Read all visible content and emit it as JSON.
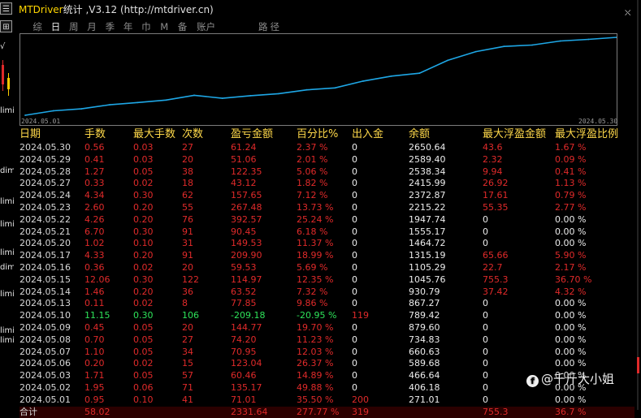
{
  "window": {
    "title_en": "MTDriver",
    "title_cn": "统计",
    "title_version": " ,V3.12 (http://mtdriver.cn)",
    "menu_glyph": "☰",
    "sidebar_icon_glyph": "⊞",
    "close_glyph": "⛌"
  },
  "left_strip_labels": [
    {
      "text": "√"
    },
    {
      "text": "limi"
    },
    {
      "text": "dimi"
    },
    {
      "text": "limi"
    },
    {
      "text": "limi"
    },
    {
      "text": "limi"
    },
    {
      "text": "dimi"
    },
    {
      "text": "limi"
    },
    {
      "text": "limi"
    },
    {
      "text": "limi"
    }
  ],
  "period_tabs": [
    {
      "label": "综",
      "active": false
    },
    {
      "label": "日",
      "active": true
    },
    {
      "label": "周",
      "active": false
    },
    {
      "label": "月",
      "active": false
    },
    {
      "label": "季",
      "active": false
    },
    {
      "label": "年",
      "active": false
    },
    {
      "label": "巾",
      "active": false
    },
    {
      "label": "M",
      "active": false
    },
    {
      "label": "备",
      "active": false
    },
    {
      "label": "账户",
      "active": false
    }
  ],
  "route_tab": "路径",
  "chart_data": {
    "type": "line",
    "x_start_label": "2024.05.01",
    "x_end_label": "2024.05.30",
    "x": [
      "2024.05.01",
      "2024.05.02",
      "2024.05.03",
      "2024.05.06",
      "2024.05.07",
      "2024.05.08",
      "2024.05.09",
      "2024.05.10",
      "2024.05.13",
      "2024.05.14",
      "2024.05.15",
      "2024.05.16",
      "2024.05.17",
      "2024.05.20",
      "2024.05.21",
      "2024.05.22",
      "2024.05.23",
      "2024.05.24",
      "2024.05.27",
      "2024.05.28",
      "2024.05.29",
      "2024.05.30"
    ],
    "values": [
      271.01,
      406.18,
      466.64,
      589.68,
      660.63,
      734.83,
      879.6,
      789.42,
      867.27,
      930.79,
      1045.76,
      1105.29,
      1315.19,
      1464.72,
      1555.17,
      1947.74,
      2215.22,
      2372.87,
      2415.99,
      2538.34,
      2589.4,
      2650.64
    ],
    "line_color": "#1ea7e6",
    "grid": false
  },
  "table": {
    "headers": [
      "日期",
      "手数",
      "最大手数",
      "次数",
      "盈亏金额",
      "百分比%",
      "出入金",
      "余额",
      "最大浮盈金额",
      "最大浮盈比例"
    ],
    "rows": [
      {
        "date": "2024.05.30",
        "lots": "0.56",
        "max_lots": "0.03",
        "count": "27",
        "pnl": "61.24",
        "pct": "2.37 %",
        "io": "0",
        "balance": "2650.64",
        "fp_amt": "43.6",
        "fp_pct": "1.67 %",
        "tone": "red"
      },
      {
        "date": "2024.05.29",
        "lots": "0.41",
        "max_lots": "0.03",
        "count": "20",
        "pnl": "51.06",
        "pct": "2.01 %",
        "io": "0",
        "balance": "2589.40",
        "fp_amt": "2.32",
        "fp_pct": "0.09 %",
        "tone": "red"
      },
      {
        "date": "2024.05.28",
        "lots": "1.27",
        "max_lots": "0.05",
        "count": "38",
        "pnl": "122.35",
        "pct": "5.06 %",
        "io": "0",
        "balance": "2538.34",
        "fp_amt": "9.94",
        "fp_pct": "0.41 %",
        "tone": "red"
      },
      {
        "date": "2024.05.27",
        "lots": "0.33",
        "max_lots": "0.02",
        "count": "18",
        "pnl": "43.12",
        "pct": "1.82 %",
        "io": "0",
        "balance": "2415.99",
        "fp_amt": "26.92",
        "fp_pct": "1.13 %",
        "tone": "red"
      },
      {
        "date": "2024.05.24",
        "lots": "4.34",
        "max_lots": "0.30",
        "count": "62",
        "pnl": "157.65",
        "pct": "7.12 %",
        "io": "0",
        "balance": "2372.87",
        "fp_amt": "17.61",
        "fp_pct": "0.79 %",
        "tone": "red"
      },
      {
        "date": "2024.05.23",
        "lots": "2.60",
        "max_lots": "0.20",
        "count": "55",
        "pnl": "267.48",
        "pct": "13.73 %",
        "io": "0",
        "balance": "2215.22",
        "fp_amt": "55.35",
        "fp_pct": "2.77 %",
        "tone": "red"
      },
      {
        "date": "2024.05.22",
        "lots": "4.26",
        "max_lots": "0.20",
        "count": "76",
        "pnl": "392.57",
        "pct": "25.24 %",
        "io": "0",
        "balance": "1947.74",
        "fp_amt": "0",
        "fp_pct": "0.00 %",
        "tone": "red"
      },
      {
        "date": "2024.05.21",
        "lots": "6.70",
        "max_lots": "0.30",
        "count": "91",
        "pnl": "90.45",
        "pct": "6.18 %",
        "io": "0",
        "balance": "1555.17",
        "fp_amt": "0",
        "fp_pct": "0.00 %",
        "tone": "red"
      },
      {
        "date": "2024.05.20",
        "lots": "1.02",
        "max_lots": "0.10",
        "count": "31",
        "pnl": "149.53",
        "pct": "11.37 %",
        "io": "0",
        "balance": "1464.72",
        "fp_amt": "0",
        "fp_pct": "0.00 %",
        "tone": "red"
      },
      {
        "date": "2024.05.17",
        "lots": "4.33",
        "max_lots": "0.20",
        "count": "91",
        "pnl": "209.90",
        "pct": "18.99 %",
        "io": "0",
        "balance": "1315.19",
        "fp_amt": "65.66",
        "fp_pct": "5.90 %",
        "tone": "red"
      },
      {
        "date": "2024.05.16",
        "lots": "0.36",
        "max_lots": "0.02",
        "count": "20",
        "pnl": "59.53",
        "pct": "5.69 %",
        "io": "0",
        "balance": "1105.29",
        "fp_amt": "22.7",
        "fp_pct": "2.17 %",
        "tone": "red"
      },
      {
        "date": "2024.05.15",
        "lots": "12.06",
        "max_lots": "0.30",
        "count": "122",
        "pnl": "114.97",
        "pct": "12.35 %",
        "io": "0",
        "balance": "1045.76",
        "fp_amt": "755.3",
        "fp_pct": "36.70 %",
        "tone": "red"
      },
      {
        "date": "2024.05.14",
        "lots": "1.46",
        "max_lots": "0.20",
        "count": "36",
        "pnl": "63.52",
        "pct": "7.32 %",
        "io": "0",
        "balance": "930.79",
        "fp_amt": "37.42",
        "fp_pct": "4.32 %",
        "tone": "red"
      },
      {
        "date": "2024.05.13",
        "lots": "0.11",
        "max_lots": "0.02",
        "count": "8",
        "pnl": "77.85",
        "pct": "9.86 %",
        "io": "0",
        "balance": "867.27",
        "fp_amt": "0",
        "fp_pct": "0.00 %",
        "tone": "red"
      },
      {
        "date": "2024.05.10",
        "lots": "11.15",
        "max_lots": "0.30",
        "count": "106",
        "pnl": "-209.18",
        "pct": "-20.95 %",
        "io": "119",
        "balance": "789.42",
        "fp_amt": "0",
        "fp_pct": "0.00 %",
        "tone": "green"
      },
      {
        "date": "2024.05.09",
        "lots": "0.45",
        "max_lots": "0.05",
        "count": "20",
        "pnl": "144.77",
        "pct": "19.70 %",
        "io": "0",
        "balance": "879.60",
        "fp_amt": "0",
        "fp_pct": "0.00 %",
        "tone": "red"
      },
      {
        "date": "2024.05.08",
        "lots": "0.70",
        "max_lots": "0.05",
        "count": "27",
        "pnl": "74.20",
        "pct": "11.23 %",
        "io": "0",
        "balance": "734.83",
        "fp_amt": "0",
        "fp_pct": "0.00 %",
        "tone": "red"
      },
      {
        "date": "2024.05.07",
        "lots": "1.10",
        "max_lots": "0.05",
        "count": "34",
        "pnl": "70.95",
        "pct": "12.03 %",
        "io": "0",
        "balance": "660.63",
        "fp_amt": "0",
        "fp_pct": "0.00 %",
        "tone": "red"
      },
      {
        "date": "2024.05.06",
        "lots": "0.20",
        "max_lots": "0.02",
        "count": "15",
        "pnl": "123.04",
        "pct": "26.37 %",
        "io": "0",
        "balance": "589.68",
        "fp_amt": "0",
        "fp_pct": "0.00 %",
        "tone": "red"
      },
      {
        "date": "2024.05.03",
        "lots": "1.71",
        "max_lots": "0.05",
        "count": "57",
        "pnl": "60.46",
        "pct": "14.89 %",
        "io": "0",
        "balance": "466.64",
        "fp_amt": "0",
        "fp_pct": "0.00 %",
        "tone": "red"
      },
      {
        "date": "2024.05.02",
        "lots": "1.95",
        "max_lots": "0.06",
        "count": "71",
        "pnl": "135.17",
        "pct": "49.88 %",
        "io": "0",
        "balance": "406.18",
        "fp_amt": "0",
        "fp_pct": "0.00 %",
        "tone": "red"
      },
      {
        "date": "2024.05.01",
        "lots": "0.95",
        "max_lots": "0.10",
        "count": "41",
        "pnl": "71.01",
        "pct": "35.50 %",
        "io": "200",
        "balance": "271.01",
        "fp_amt": "0",
        "fp_pct": "0.00 %",
        "tone": "red"
      }
    ],
    "total": {
      "label": "合计",
      "lots": "58.02",
      "pnl": "2331.64",
      "pct": "277.77 %",
      "io": "319",
      "fp_amt": "755.3",
      "fp_pct": "36.7 %"
    }
  },
  "watermark": {
    "icon_glyph": "f",
    "text": "@千斤大小姐"
  },
  "colors": {
    "positive": "#e02a2a",
    "negative": "#2ee35a",
    "header": "#ffd94a",
    "title": "#ffd600"
  }
}
